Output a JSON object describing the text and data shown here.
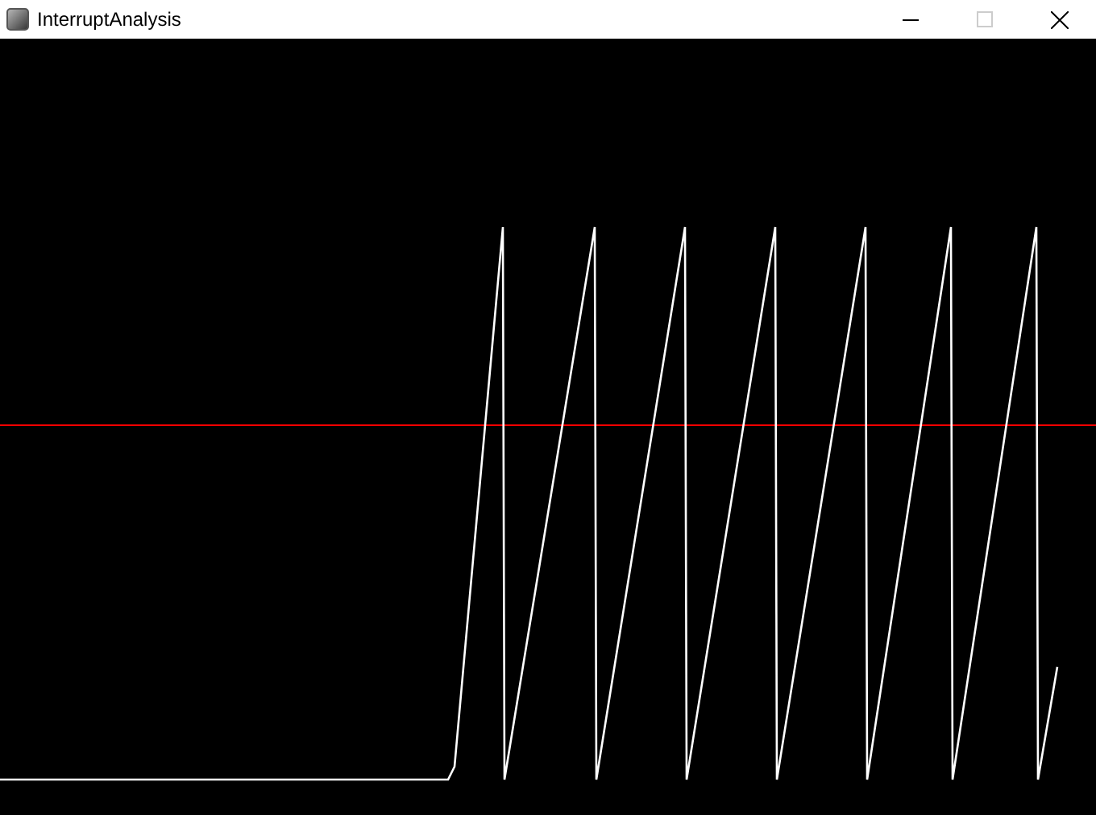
{
  "window": {
    "title": "InterruptAnalysis",
    "maximize": {
      "disabled": true
    }
  }
}
